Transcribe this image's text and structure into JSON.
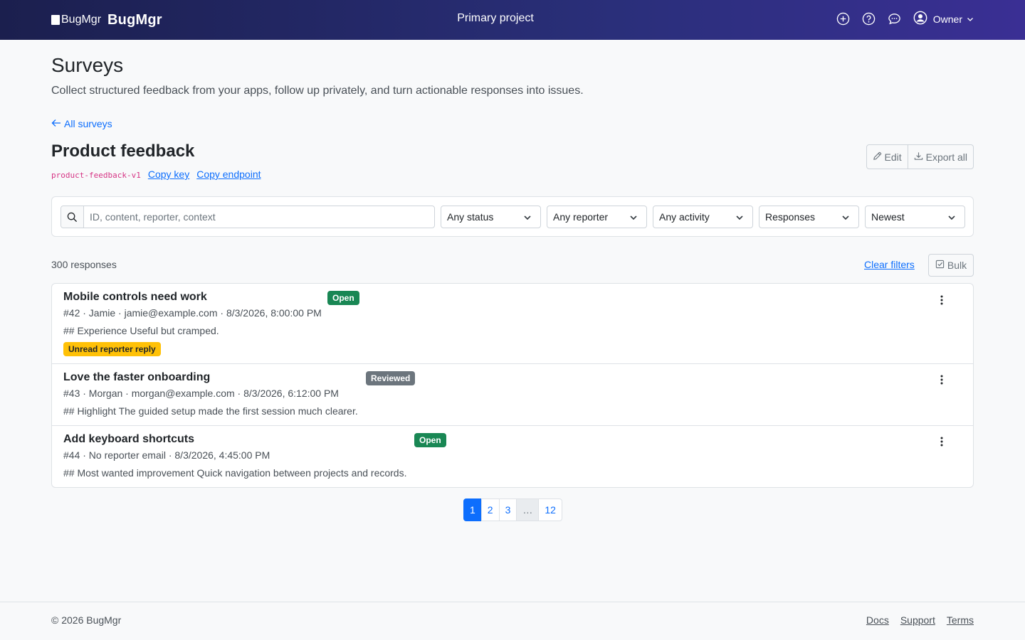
{
  "header": {
    "logo_alt": "BugMgr",
    "brand": "BugMgr",
    "project": "Primary project",
    "user": "Owner",
    "icons": [
      "plus-circle-icon",
      "question-circle-icon",
      "chat-icon",
      "user-circle-icon"
    ]
  },
  "intro": {
    "title": "Surveys",
    "lead": "Collect structured feedback from your apps, follow up privately, and turn actionable responses into issues."
  },
  "back_link": "All surveys",
  "survey": {
    "title": "Product feedback",
    "key": "product-feedback-v1",
    "copy_key": "Copy key",
    "copy_endpoint": "Copy endpoint",
    "edit": "Edit",
    "export": "Export all"
  },
  "filters": {
    "search_placeholder": "ID, content, reporter, context",
    "status": "Any status",
    "reporter": "Any reporter",
    "activity": "Any activity",
    "view": "Responses",
    "sort": "Newest"
  },
  "results": {
    "count": "300 responses",
    "clear": "Clear filters",
    "bulk": "Bulk"
  },
  "responses": [
    {
      "title": "Mobile controls need work",
      "status": "Open",
      "meta": "#42 · Jamie · jamie@example.com · 8/3/2026, 8:00:00 PM",
      "body": "## Experience Useful but cramped.",
      "flag": "Unread reporter reply"
    },
    {
      "title": "Love the faster onboarding",
      "status": "Reviewed",
      "meta": "#43 · Morgan · morgan@example.com · 8/3/2026, 6:12:00 PM",
      "body": "## Highlight The guided setup made the first session much clearer.",
      "flag": ""
    },
    {
      "title": "Add keyboard shortcuts",
      "status": "Open",
      "meta": "#44 · No reporter email · 8/3/2026, 4:45:00 PM",
      "body": "## Most wanted improvement Quick navigation between projects and records.",
      "flag": ""
    }
  ],
  "pagination": {
    "p1": "1",
    "p2": "2",
    "p3": "3",
    "ellipsis": "…",
    "last": "12"
  },
  "footer": {
    "copyright": "© 2026 BugMgr",
    "docs": "Docs",
    "support": "Support",
    "terms": "Terms"
  },
  "colors": {
    "header_start": "#1b1f4e",
    "header_end": "#3a2f94",
    "link": "#0d6efd",
    "badge_open": "#198754",
    "badge_reviewed": "#6c757d",
    "badge_unread": "#ffc107",
    "survey_key": "#d63384"
  }
}
